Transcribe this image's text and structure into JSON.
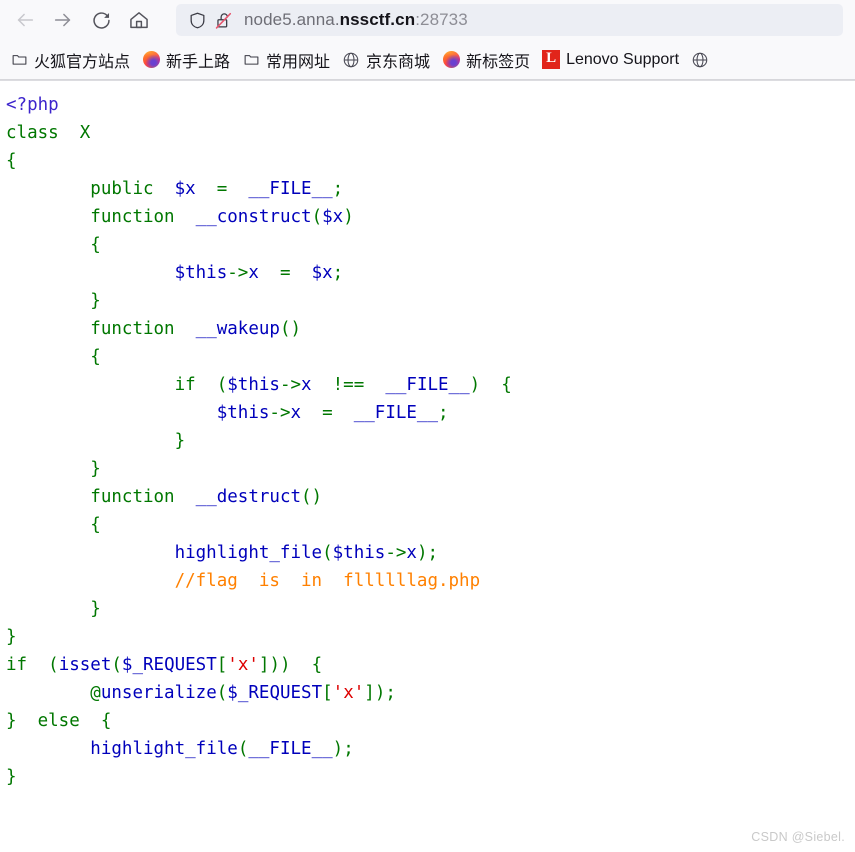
{
  "browser": {
    "nav": {
      "back_icon": "arrow-left-icon",
      "forward_icon": "arrow-right-icon",
      "reload_icon": "reload-icon",
      "home_icon": "home-icon"
    },
    "urlbar": {
      "shield_icon": "shield-icon",
      "security_icon": "unlocked-padlock-crossed-icon",
      "url_prefix": "node5.anna.",
      "url_domain": "nssctf.cn",
      "url_port": ":28733",
      "full_url": "node5.anna.nssctf.cn:28733"
    },
    "bookmarks": [
      {
        "label": "火狐官方站点",
        "icon": "folder-icon"
      },
      {
        "label": "新手上路",
        "icon": "firefox-icon"
      },
      {
        "label": "常用网址",
        "icon": "folder-icon"
      },
      {
        "label": "京东商城",
        "icon": "globe-icon"
      },
      {
        "label": "新标签页",
        "icon": "firefox-icon"
      },
      {
        "label": "Lenovo Support",
        "icon": "lenovo-icon"
      },
      {
        "label": "",
        "icon": "globe-icon"
      }
    ]
  },
  "page": {
    "code_lines": [
      [
        {
          "t": "<?php",
          "c": "t-php"
        }
      ],
      [
        {
          "t": "class  X",
          "c": "t-kw"
        }
      ],
      [
        {
          "t": "{",
          "c": "t-kw"
        }
      ],
      [
        {
          "t": "        ",
          "c": "t-def"
        },
        {
          "t": "public  ",
          "c": "t-kw"
        },
        {
          "t": "$x",
          "c": "t-var"
        },
        {
          "t": "  =  ",
          "c": "t-kw"
        },
        {
          "t": "__FILE__",
          "c": "t-var"
        },
        {
          "t": ";",
          "c": "t-kw"
        }
      ],
      [
        {
          "t": "        ",
          "c": "t-def"
        },
        {
          "t": "function  ",
          "c": "t-kw"
        },
        {
          "t": "__construct",
          "c": "t-var"
        },
        {
          "t": "(",
          "c": "t-kw"
        },
        {
          "t": "$x",
          "c": "t-var"
        },
        {
          "t": ")",
          "c": "t-kw"
        }
      ],
      [
        {
          "t": "        ",
          "c": "t-def"
        },
        {
          "t": "{",
          "c": "t-kw"
        }
      ],
      [
        {
          "t": "                ",
          "c": "t-def"
        },
        {
          "t": "$this",
          "c": "t-var"
        },
        {
          "t": "->",
          "c": "t-kw"
        },
        {
          "t": "x",
          "c": "t-var"
        },
        {
          "t": "  =  ",
          "c": "t-kw"
        },
        {
          "t": "$x",
          "c": "t-var"
        },
        {
          "t": ";",
          "c": "t-kw"
        }
      ],
      [
        {
          "t": "        ",
          "c": "t-def"
        },
        {
          "t": "}",
          "c": "t-kw"
        }
      ],
      [
        {
          "t": "        ",
          "c": "t-def"
        },
        {
          "t": "function  ",
          "c": "t-kw"
        },
        {
          "t": "__wakeup",
          "c": "t-var"
        },
        {
          "t": "()",
          "c": "t-kw"
        }
      ],
      [
        {
          "t": "        ",
          "c": "t-def"
        },
        {
          "t": "{",
          "c": "t-kw"
        }
      ],
      [
        {
          "t": "                ",
          "c": "t-def"
        },
        {
          "t": "if  (",
          "c": "t-kw"
        },
        {
          "t": "$this",
          "c": "t-var"
        },
        {
          "t": "->",
          "c": "t-kw"
        },
        {
          "t": "x",
          "c": "t-var"
        },
        {
          "t": "  !==  ",
          "c": "t-kw"
        },
        {
          "t": "__FILE__",
          "c": "t-var"
        },
        {
          "t": ")  {",
          "c": "t-kw"
        }
      ],
      [
        {
          "t": "                    ",
          "c": "t-def"
        },
        {
          "t": "$this",
          "c": "t-var"
        },
        {
          "t": "->",
          "c": "t-kw"
        },
        {
          "t": "x",
          "c": "t-var"
        },
        {
          "t": "  =  ",
          "c": "t-kw"
        },
        {
          "t": "__FILE__",
          "c": "t-var"
        },
        {
          "t": ";",
          "c": "t-kw"
        }
      ],
      [
        {
          "t": "                ",
          "c": "t-def"
        },
        {
          "t": "}",
          "c": "t-kw"
        }
      ],
      [
        {
          "t": "        ",
          "c": "t-def"
        },
        {
          "t": "}",
          "c": "t-kw"
        }
      ],
      [
        {
          "t": "        ",
          "c": "t-def"
        },
        {
          "t": "function  ",
          "c": "t-kw"
        },
        {
          "t": "__destruct",
          "c": "t-var"
        },
        {
          "t": "()",
          "c": "t-kw"
        }
      ],
      [
        {
          "t": "        ",
          "c": "t-def"
        },
        {
          "t": "{",
          "c": "t-kw"
        }
      ],
      [
        {
          "t": "                ",
          "c": "t-def"
        },
        {
          "t": "highlight_file",
          "c": "t-var"
        },
        {
          "t": "(",
          "c": "t-kw"
        },
        {
          "t": "$this",
          "c": "t-var"
        },
        {
          "t": "->",
          "c": "t-kw"
        },
        {
          "t": "x",
          "c": "t-var"
        },
        {
          "t": ");",
          "c": "t-kw"
        }
      ],
      [
        {
          "t": "                ",
          "c": "t-def"
        },
        {
          "t": "//flag  is  in  fllllllag.php",
          "c": "t-cmt"
        }
      ],
      [
        {
          "t": "        ",
          "c": "t-def"
        },
        {
          "t": "}",
          "c": "t-kw"
        }
      ],
      [
        {
          "t": "}",
          "c": "t-kw"
        }
      ],
      [
        {
          "t": "if  (",
          "c": "t-kw"
        },
        {
          "t": "isset",
          "c": "t-var"
        },
        {
          "t": "(",
          "c": "t-kw"
        },
        {
          "t": "$_REQUEST",
          "c": "t-var"
        },
        {
          "t": "[",
          "c": "t-kw"
        },
        {
          "t": "'x'",
          "c": "t-str"
        },
        {
          "t": "]))  {",
          "c": "t-kw"
        }
      ],
      [
        {
          "t": "        ",
          "c": "t-def"
        },
        {
          "t": "@",
          "c": "t-kw"
        },
        {
          "t": "unserialize",
          "c": "t-var"
        },
        {
          "t": "(",
          "c": "t-kw"
        },
        {
          "t": "$_REQUEST",
          "c": "t-var"
        },
        {
          "t": "[",
          "c": "t-kw"
        },
        {
          "t": "'x'",
          "c": "t-str"
        },
        {
          "t": "]);",
          "c": "t-kw"
        }
      ],
      [
        {
          "t": "}  else  {",
          "c": "t-kw"
        }
      ],
      [
        {
          "t": "        ",
          "c": "t-def"
        },
        {
          "t": "highlight_file",
          "c": "t-var"
        },
        {
          "t": "(",
          "c": "t-kw"
        },
        {
          "t": "__FILE__",
          "c": "t-var"
        },
        {
          "t": ");",
          "c": "t-kw"
        }
      ],
      [
        {
          "t": "}",
          "c": "t-kw"
        }
      ]
    ],
    "watermark": "CSDN @Siebel."
  },
  "colors": {
    "chrome_bg": "#f9f9fb",
    "urlbar_bg": "#eceef4",
    "code_keyword": "#007700",
    "code_variable": "#0000bb",
    "code_string": "#dd0000",
    "code_comment": "#ff8000",
    "code_opentag": "#3c24cc",
    "lenovo_red": "#e1251b",
    "insecure_red": "#e8546d"
  }
}
